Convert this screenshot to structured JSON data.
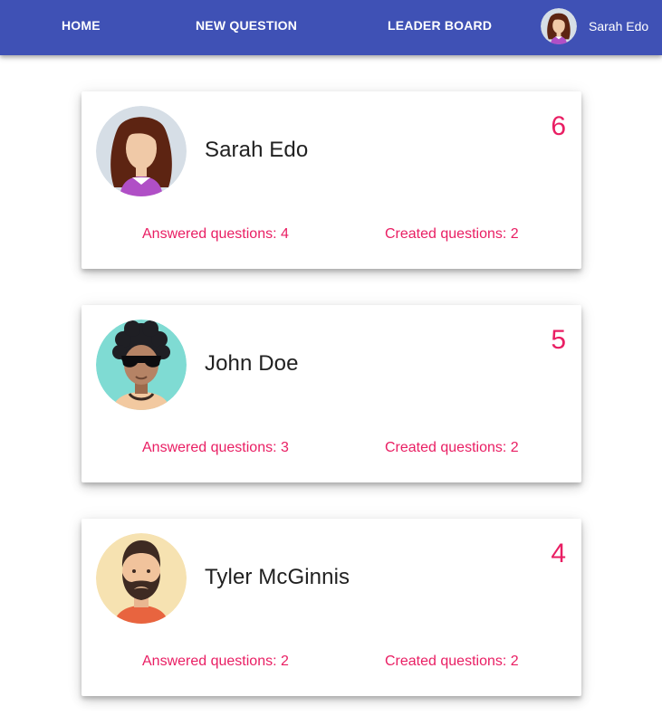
{
  "colors": {
    "appbar": "#3f51b5",
    "accent": "#e91e63",
    "text": "#212121",
    "background": "#ffffff"
  },
  "nav": {
    "home": "HOME",
    "new_question": "NEW QUESTION",
    "leader_board": "LEADER BOARD",
    "user": {
      "name": "Sarah Edo",
      "avatar_icon": "female-avatar-icon"
    }
  },
  "leaderboard": [
    {
      "name": "Sarah Edo",
      "score": "6",
      "answered": "Answered questions: 4",
      "created": "Created questions: 2",
      "avatar_icon": "female-avatar-icon"
    },
    {
      "name": "John Doe",
      "score": "5",
      "answered": "Answered questions: 3",
      "created": "Created questions: 2",
      "avatar_icon": "male-afro-sunglasses-avatar-icon"
    },
    {
      "name": "Tyler McGinnis",
      "score": "4",
      "answered": "Answered questions: 2",
      "created": "Created questions: 2",
      "avatar_icon": "male-bearded-avatar-icon"
    }
  ]
}
